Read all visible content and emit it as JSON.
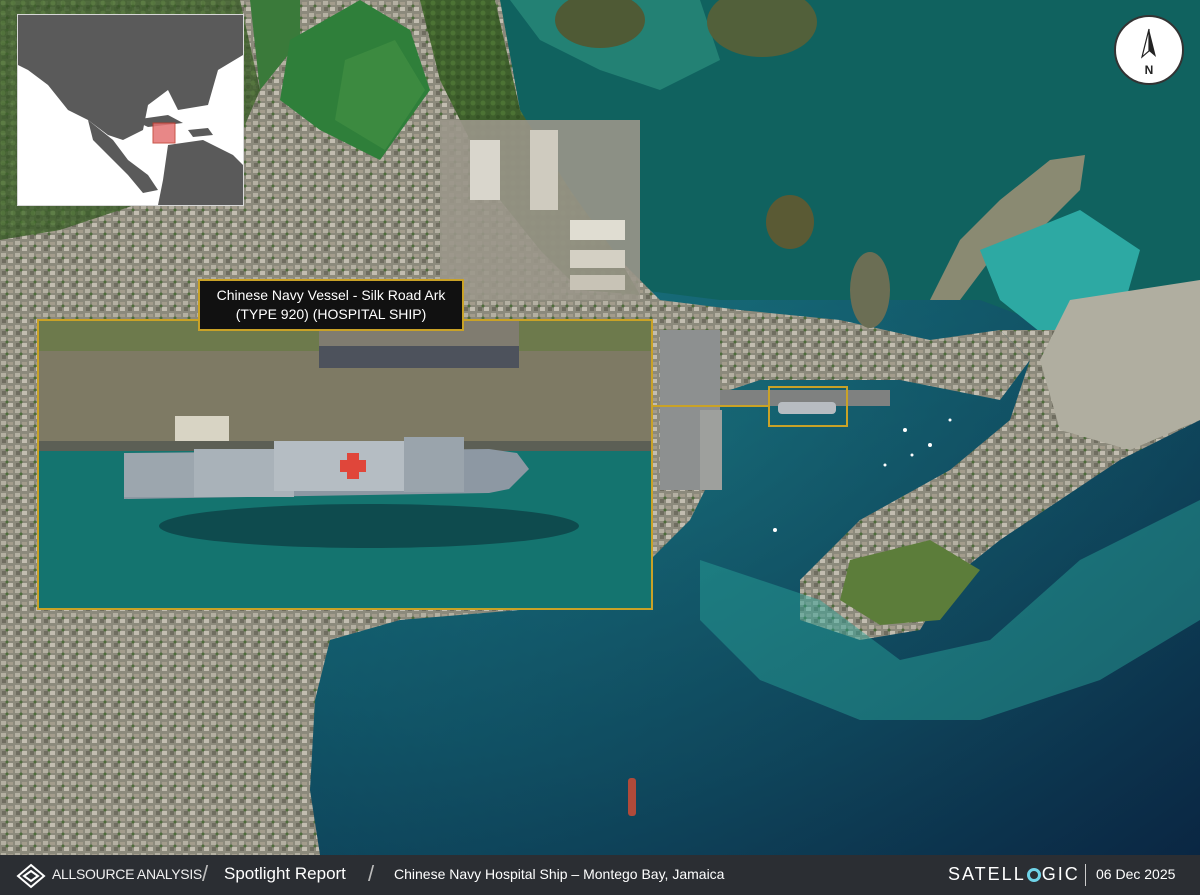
{
  "callout": {
    "line1": "Chinese Navy Vessel - Silk Road Ark",
    "line2": "(TYPE 920) (HOSPITAL SHIP)",
    "accent_color": "#c9a227"
  },
  "north_arrow": {
    "label": "N",
    "icon": "north-arrow-icon"
  },
  "inset_map": {
    "icon": "locator-map",
    "highlight_color": "#e57373"
  },
  "footer": {
    "org_name": "ALLSOURCE ANALYSIS",
    "report_type": "Spotlight Report",
    "title": "Chinese Navy Hospital Ship – Montego Bay, Jamaica",
    "partner_left": "SATELL",
    "partner_right": "GIC",
    "date": "06 Dec 2025"
  }
}
